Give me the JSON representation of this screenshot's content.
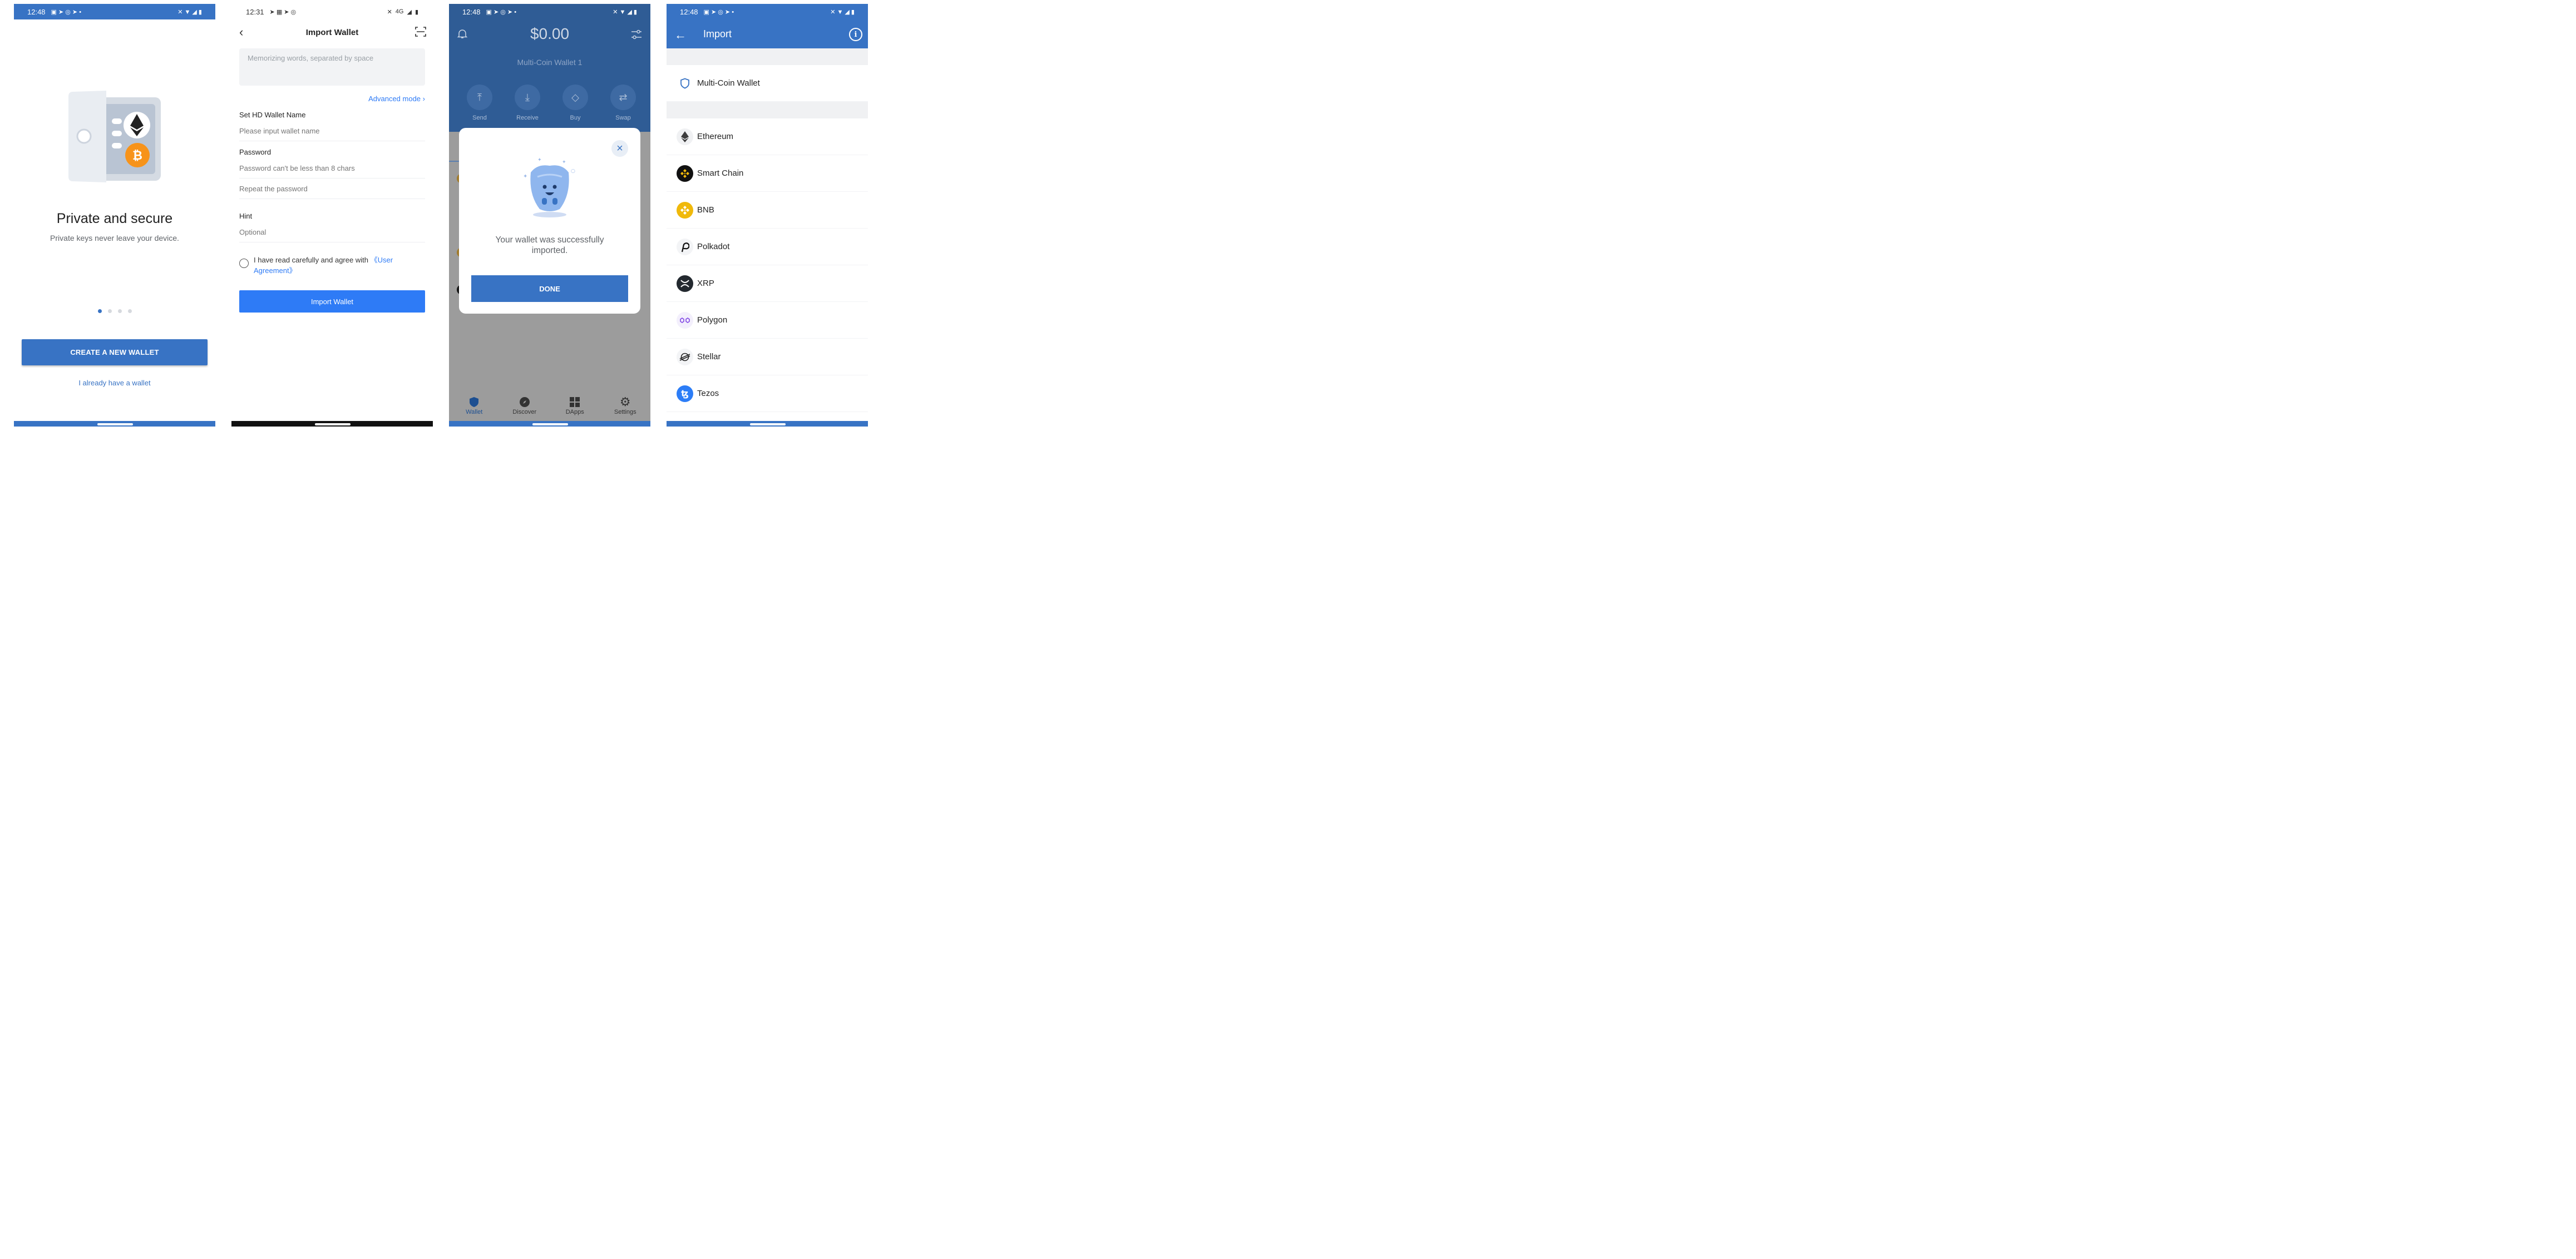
{
  "screen1": {
    "status_time": "12:48",
    "title": "Private and secure",
    "subtitle": "Private keys never leave your device.",
    "create_button": "CREATE A NEW WALLET",
    "have_wallet_link": "I already have a wallet",
    "page_dots": 4,
    "active_dot": 1
  },
  "screen2": {
    "status_time": "12:31",
    "network": "4G",
    "header_title": "Import Wallet",
    "mnemonic_placeholder": "Memorizing words, separated by space",
    "advanced_mode": "Advanced mode",
    "name_label": "Set HD Wallet Name",
    "name_placeholder": "Please input wallet name",
    "password_label": "Password",
    "password_placeholder": "Password can't be less than 8 chars",
    "repeat_placeholder": "Repeat the password",
    "hint_label": "Hint",
    "hint_placeholder": "Optional",
    "agree_text": "I have read carefully and agree with ",
    "agree_link": "《User Agreement》",
    "import_button": "Import Wallet"
  },
  "screen3": {
    "status_time": "12:48",
    "balance": "$0.00",
    "wallet_name": "Multi-Coin Wallet 1",
    "actions": [
      {
        "label": "Send",
        "icon": "send-icon"
      },
      {
        "label": "Receive",
        "icon": "receive-icon"
      },
      {
        "label": "Buy",
        "icon": "buy-tag-icon"
      },
      {
        "label": "Swap",
        "icon": "swap-icon"
      }
    ],
    "modal_message": "Your wallet was successfully imported.",
    "done_button": "DONE",
    "tabs": [
      {
        "label": "Wallet",
        "icon": "shield-icon"
      },
      {
        "label": "Discover",
        "icon": "compass-icon"
      },
      {
        "label": "DApps",
        "icon": "grid-icon"
      },
      {
        "label": "Settings",
        "icon": "gear-icon"
      }
    ]
  },
  "screen4": {
    "status_time": "12:48",
    "header_title": "Import",
    "multi_coin": "Multi-Coin Wallet",
    "coins": [
      {
        "name": "Ethereum",
        "icon": "ethereum-icon",
        "color": "#3c3c3d"
      },
      {
        "name": "Smart Chain",
        "icon": "smart-chain-icon",
        "color": "#f0b90b"
      },
      {
        "name": "BNB",
        "icon": "bnb-icon",
        "color": "#f0b90b"
      },
      {
        "name": "Polkadot",
        "icon": "polkadot-icon",
        "color": "#1a1a1a"
      },
      {
        "name": "XRP",
        "icon": "xrp-icon",
        "color": "#23292f"
      },
      {
        "name": "Polygon",
        "icon": "polygon-icon",
        "color": "#8247e5"
      },
      {
        "name": "Stellar",
        "icon": "stellar-icon",
        "color": "#222222"
      },
      {
        "name": "Tezos",
        "icon": "tezos-icon",
        "color": "#2c7df7"
      }
    ]
  },
  "colors": {
    "primary": "#3873c4",
    "import_blue": "#2e7bf6",
    "wallet_header": "#2f5c95"
  }
}
